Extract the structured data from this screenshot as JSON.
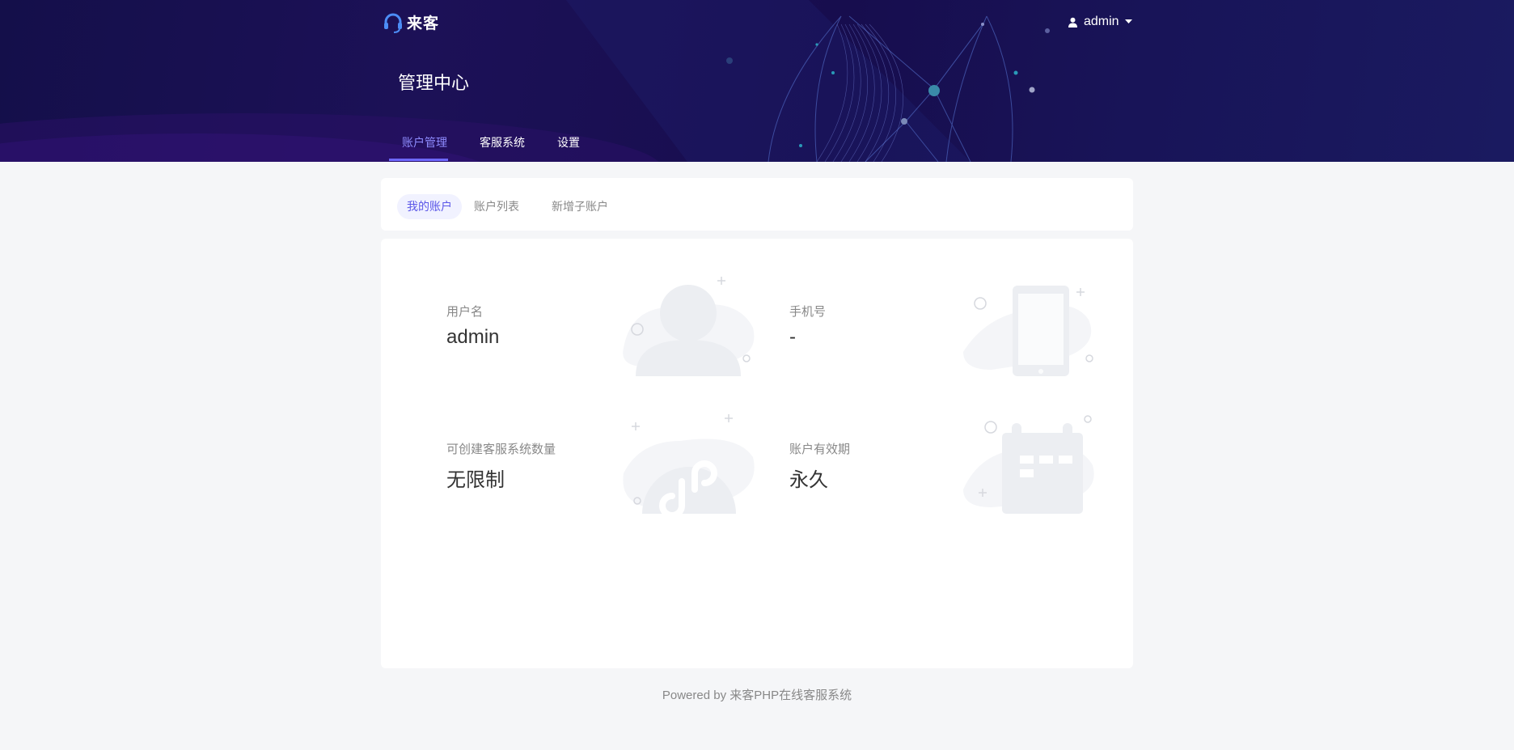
{
  "app": {
    "logo_text": "来客",
    "title": "管理中心"
  },
  "user_menu": {
    "username": "admin"
  },
  "nav": {
    "tabs": [
      "账户管理",
      "客服系统",
      "设置"
    ],
    "active": 0
  },
  "subtabs": {
    "items": [
      "我的账户",
      "账户列表",
      "新增子账户"
    ],
    "active": 0
  },
  "account": {
    "username": {
      "label": "用户名",
      "value": "admin",
      "icon": "user-icon"
    },
    "phone": {
      "label": "手机号",
      "value": "-",
      "icon": "phone-icon"
    },
    "quota": {
      "label": "可创建客服系统数量",
      "value": "无限制",
      "icon": "mini-program-icon"
    },
    "validity": {
      "label": "账户有效期",
      "value": "永久",
      "icon": "calendar-icon"
    }
  },
  "footer": {
    "text": "Powered by 来客PHP在线客服系统"
  },
  "colors": {
    "accent": "#6e68ff",
    "header_bg": "#170d4e",
    "page_bg": "#f5f6f8",
    "illus": "#eceef2"
  }
}
